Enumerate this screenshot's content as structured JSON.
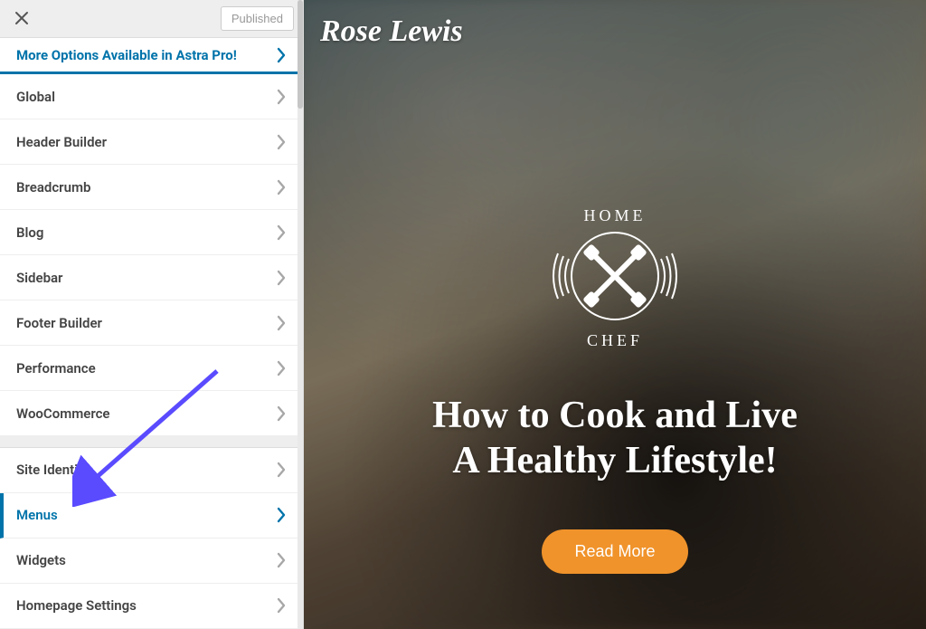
{
  "header": {
    "published_label": "Published"
  },
  "promo": {
    "label": "More Options Available in Astra Pro!"
  },
  "sections_group1": [
    {
      "label": "Global"
    },
    {
      "label": "Header Builder"
    },
    {
      "label": "Breadcrumb"
    },
    {
      "label": "Blog"
    },
    {
      "label": "Sidebar"
    },
    {
      "label": "Footer Builder"
    },
    {
      "label": "Performance"
    },
    {
      "label": "WooCommerce"
    }
  ],
  "sections_group2": [
    {
      "label": "Site Identity",
      "active": false
    },
    {
      "label": "Menus",
      "active": true
    },
    {
      "label": "Widgets",
      "active": false
    },
    {
      "label": "Homepage Settings",
      "active": false
    }
  ],
  "preview": {
    "brand": "Rose Lewis",
    "logo_top": "HOME",
    "logo_bottom": "CHEF",
    "headline_line1": "How to Cook and Live",
    "headline_line2": "A Healthy Lifestyle!",
    "cta_label": "Read More"
  }
}
